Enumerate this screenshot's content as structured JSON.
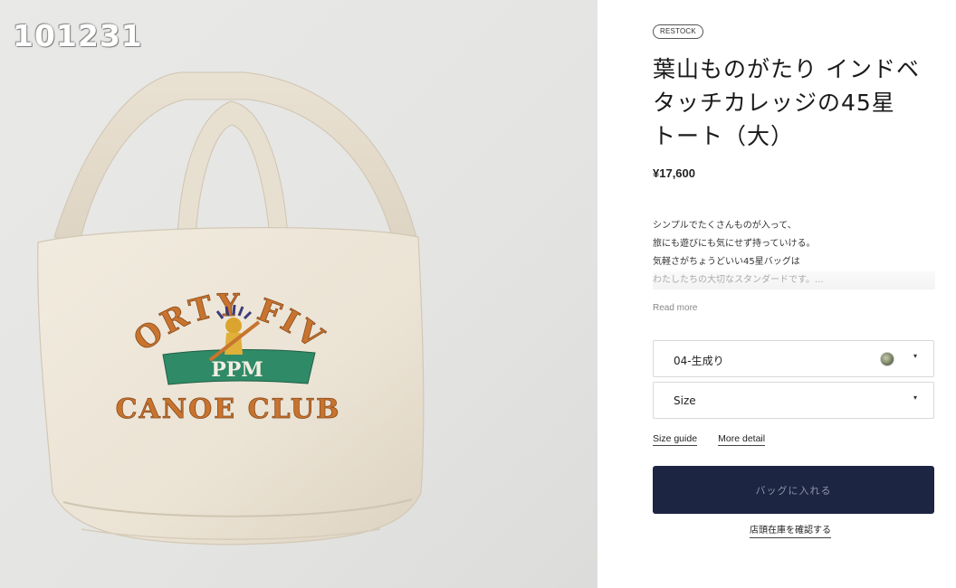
{
  "image": {
    "watermark": "101231",
    "print_top": "FORTY FIVE",
    "print_banner": "PPM",
    "print_bottom": "CANOE CLUB"
  },
  "product": {
    "badge": "RESTOCK",
    "title_lines": [
      "葉山ものがたり インドベ",
      "タッチカレッジの45星",
      "トート（大）"
    ],
    "price": "¥17,600",
    "description_lines": [
      "シンプルでたくさんものが入って、",
      "旅にも遊びにも気にせず持っていける。",
      "気軽さがちょうどいい45星バッグは",
      "わたしたちの大切なスタンダードです。..."
    ],
    "read_more": "Read more"
  },
  "options": {
    "color_value": "04-生成り",
    "size_value": "Size",
    "caret": "▾"
  },
  "links": {
    "size_guide": "Size guide",
    "more_detail": "More detail"
  },
  "actions": {
    "add_to_bag": "バッグに入れる",
    "check_store_stock": "店頭在庫を確認する"
  },
  "colors": {
    "primary_button": "#1c2542",
    "bag_canvas": "#ece4d6",
    "print_orange": "#c8742e",
    "print_green": "#2f8a67"
  },
  "icons": [
    "color-swatch-icon",
    "dropdown-caret-icon"
  ]
}
